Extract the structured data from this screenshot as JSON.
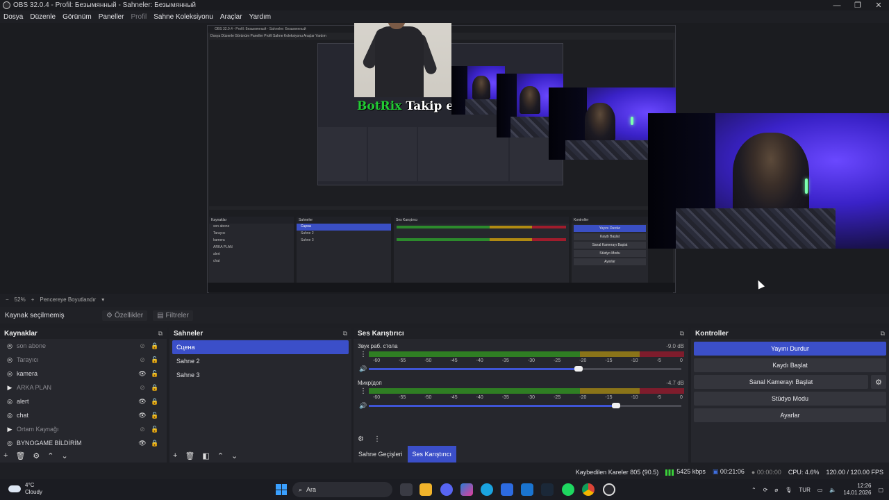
{
  "window": {
    "title": "OBS 32.0.4 - Profil: Безымянный - Sahneler: Безымянный",
    "minimize": "—",
    "maximize": "❐",
    "close": "✕"
  },
  "menu": [
    "Dosya",
    "Düzenle",
    "Görünüm",
    "Paneller",
    "Profil",
    "Sahne Koleksiyonu",
    "Araçlar",
    "Yardım"
  ],
  "preview": {
    "alert_brand": "BotRix",
    "alert_text": "Takip etdi!",
    "nested_title": "OBS 32.0.4 - Profil: Безымянный - Sahneler: Безымянный",
    "nested_menu": "Dosya  Düzenle  Görünüm  Paneller  Profil  Sahne Koleksiyonu  Araçlar  Yardım"
  },
  "zoom": {
    "minus": "−",
    "value": "52%",
    "plus": "+",
    "fit": "Pencereye Boyutlandır",
    "dropdown": "▾"
  },
  "context": {
    "no_source": "Kaynak seçilmemiş",
    "properties": "Özellikler",
    "filters": "Filtreler"
  },
  "sources": {
    "title": "Kaynaklar",
    "items": [
      {
        "name": "son abone",
        "icon": "◎",
        "visible": false,
        "locked": true,
        "dim": true
      },
      {
        "name": "Tarayıcı",
        "icon": "◎",
        "visible": false,
        "locked": false,
        "dim": true
      },
      {
        "name": "kamera",
        "icon": "◎",
        "visible": true,
        "locked": false,
        "dim": false
      },
      {
        "name": "ARKA PLAN",
        "icon": "▶",
        "visible": false,
        "locked": true,
        "dim": true
      },
      {
        "name": "alert",
        "icon": "◎",
        "visible": true,
        "locked": true,
        "dim": false
      },
      {
        "name": "chat",
        "icon": "◎",
        "visible": true,
        "locked": false,
        "dim": false
      },
      {
        "name": "Ortam Kaynağı",
        "icon": "▶",
        "visible": false,
        "locked": false,
        "dim": true
      },
      {
        "name": "BYNOGAME BİLDİRİM",
        "icon": "◎",
        "visible": true,
        "locked": true,
        "dim": false
      }
    ]
  },
  "scenes": {
    "title": "Sahneler",
    "items": [
      "Сцена",
      "Sahne 2",
      "Sahne 3"
    ]
  },
  "mixer": {
    "title": "Ses Karıştırıcı",
    "channels": [
      {
        "name": "Звук раб. стола",
        "db": "-9.0 dB",
        "volume": 0.67
      },
      {
        "name": "Микр/доп",
        "db": "-4.7 dB",
        "volume": 0.79
      }
    ],
    "ticks": [
      "-60",
      "-55",
      "-50",
      "-45",
      "-40",
      "-35",
      "-30",
      "-25",
      "-20",
      "-15",
      "-10",
      "-5",
      "0"
    ],
    "tabs": [
      "Sahne Geçişleri",
      "Ses Karıştırıcı"
    ]
  },
  "controls": {
    "title": "Kontroller",
    "buttons": [
      "Yayını Durdur",
      "Kaydı Başlat",
      "Sanal Kamerayı Başlat",
      "Stüdyo Modu",
      "Ayarlar"
    ]
  },
  "status": {
    "dropped": "Kaybedilen Kareler 805 (90.5)",
    "bitrate": "5425 kbps",
    "stream_time": "00:21:06",
    "rec_time": "00:00:00",
    "cpu": "CPU: 4.6%",
    "fps": "120.00 / 120.00 FPS"
  },
  "taskbar": {
    "temp": "4°C",
    "weather": "Cloudy",
    "search": "Ara",
    "lang": "TUR",
    "time": "12:26",
    "date": "14.01.2026"
  },
  "colors": {
    "accent": "#3b4fc9",
    "meter_green": "#2f7e23",
    "meter_yellow": "#8a7419",
    "meter_red": "#7e1c2c"
  }
}
